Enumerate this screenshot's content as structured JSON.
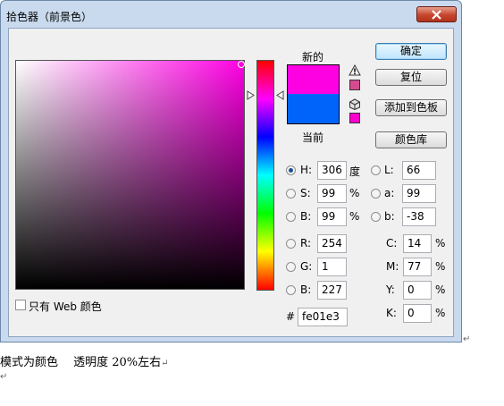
{
  "window": {
    "title": "拾色器（前景色）"
  },
  "swatches": {
    "new_label": "新的",
    "current_label": "当前",
    "new_color": "#fe01e3",
    "current_color": "#0064fa",
    "warning_color": "#d44c8f",
    "websafe_color": "#ff00cc"
  },
  "buttons": {
    "ok": "确定",
    "reset": "复位",
    "add_swatch": "添加到色板",
    "libraries": "颜色库"
  },
  "hsb": {
    "h_label": "H:",
    "h_value": "306",
    "h_unit": "度",
    "s_label": "S:",
    "s_value": "99",
    "s_unit": "%",
    "b_label": "B:",
    "b_value": "99",
    "b_unit": "%",
    "selected": "H"
  },
  "lab": {
    "l_label": "L:",
    "l_value": "66",
    "a_label": "a:",
    "a_value": "99",
    "b_label": "b:",
    "b_value": "-38"
  },
  "rgb": {
    "r_label": "R:",
    "r_value": "254",
    "g_label": "G:",
    "g_value": "1",
    "b_label": "B:",
    "b_value": "227"
  },
  "cmyk": {
    "c_label": "C:",
    "c_value": "14",
    "m_label": "M:",
    "m_value": "77",
    "y_label": "Y:",
    "y_value": "0",
    "k_label": "K:",
    "k_value": "0",
    "unit": "%"
  },
  "hex": {
    "label": "#",
    "value": "fe01e3"
  },
  "web_only": {
    "label": "只有 Web 颜色",
    "checked": false
  },
  "hue_level": 0.15,
  "below_text": "模式为颜色　 透明度 20%左右"
}
